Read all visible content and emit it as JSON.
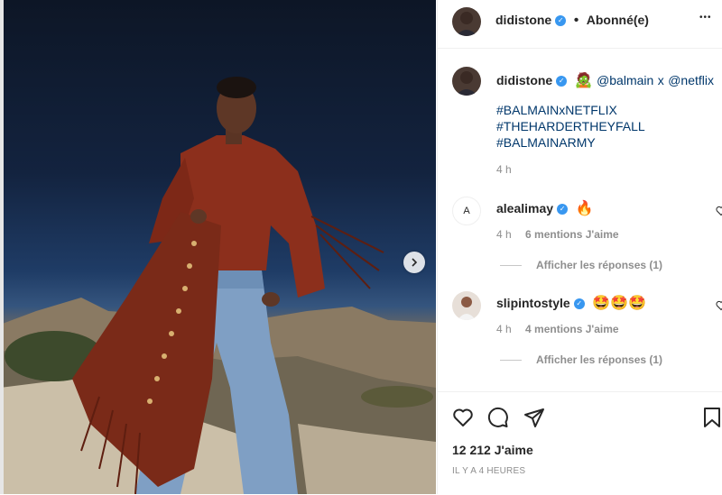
{
  "post": {
    "header": {
      "username": "didistone",
      "separator": "•",
      "follow_status": "Abonné(e)",
      "more_label": "•••"
    },
    "caption": {
      "username": "didistone",
      "emoji": "🧟",
      "mention_1": "@balmain",
      "x_text": "x",
      "mention_2": "@netflix",
      "hashtags": [
        "#BALMAINxNETFLIX",
        "#THEHARDERTHEYFALL",
        "#BALMAINARMY"
      ],
      "time": "4 h"
    },
    "comments": [
      {
        "username": "alealimay",
        "text": "🔥",
        "time": "4 h",
        "likes": "6 mentions J'aime",
        "replies": "Afficher les réponses (1)",
        "avatar_letter": "A"
      },
      {
        "username": "slipintostyle",
        "text": "🤩🤩🤩",
        "time": "4 h",
        "likes": "4 mentions J'aime",
        "replies": "Afficher les réponses (1)"
      }
    ],
    "likes": "12 212 J'aime",
    "timestamp": "IL Y A 4 HEURES"
  },
  "colors": {
    "accent": "#3897f0",
    "link": "#00376b",
    "muted": "#8e8e8e",
    "jacket": "#8c2f1c",
    "jeans": "#7f9fc4"
  },
  "icons": [
    "chevron-right-icon",
    "verified-icon",
    "heart-icon",
    "comment-icon",
    "share-icon",
    "bookmark-icon"
  ]
}
